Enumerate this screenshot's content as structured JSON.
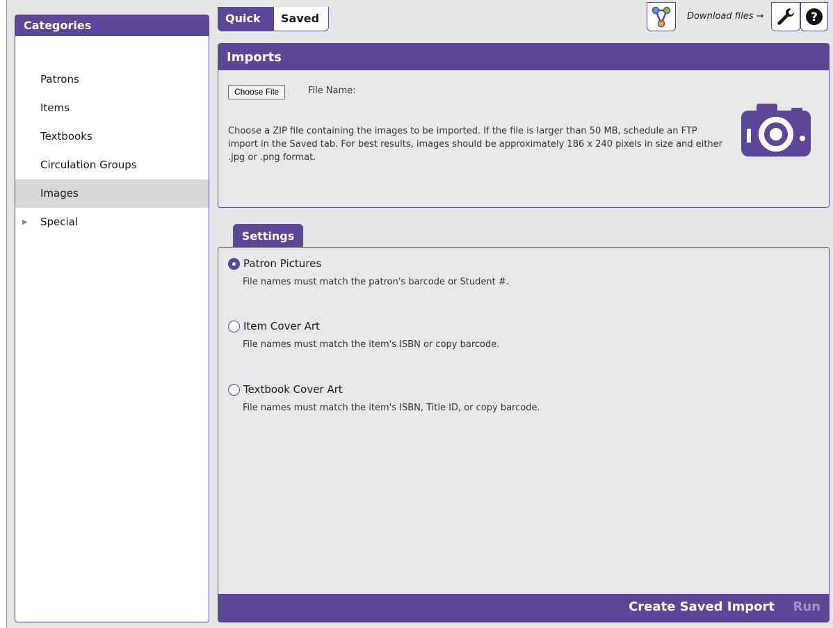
{
  "sidebar": {
    "title": "Categories",
    "items": [
      {
        "label": "Patrons"
      },
      {
        "label": "Items"
      },
      {
        "label": "Textbooks"
      },
      {
        "label": "Circulation Groups"
      },
      {
        "label": "Images",
        "active": true
      },
      {
        "label": "Special",
        "expandable": true
      }
    ]
  },
  "tabs": {
    "quick": "Quick",
    "saved": "Saved",
    "active": "Quick"
  },
  "toolbar": {
    "download_label": "Download files →",
    "icons": [
      "workflow-icon",
      "wrench-icon",
      "help-icon"
    ]
  },
  "imports": {
    "title": "Imports",
    "choose_file_label": "Choose File",
    "file_name_label": "File Name:",
    "description": "Choose a ZIP file containing the images to be imported. If the file is larger than 50 MB, schedule an FTP import in the Saved tab. For best results, images should be approximately 186 x 240 pixels in size and either .jpg or .png format."
  },
  "settings": {
    "title": "Settings",
    "options": [
      {
        "label": "Patron Pictures",
        "desc": "File names must match the patron's barcode or Student #.",
        "checked": true
      },
      {
        "label": "Item Cover Art",
        "desc": "File names must match the item's ISBN or copy barcode.",
        "checked": false
      },
      {
        "label": "Textbook Cover Art",
        "desc": "File names must match the item's ISBN, Title ID, or copy barcode.",
        "checked": false
      }
    ]
  },
  "footer": {
    "create_label": "Create Saved Import",
    "run_label": "Run"
  },
  "colors": {
    "accent": "#5a4796",
    "disabled": "#9f95c4"
  }
}
